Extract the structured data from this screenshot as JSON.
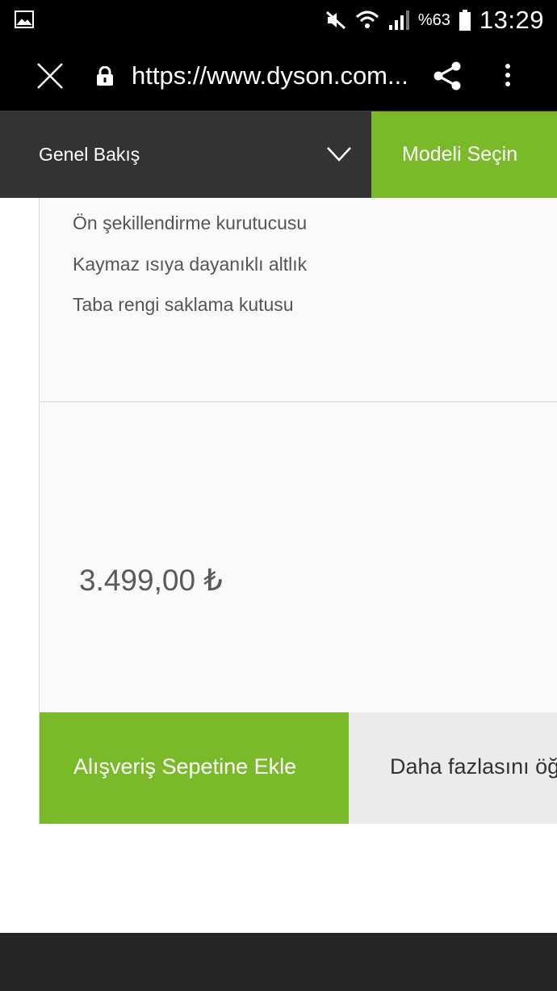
{
  "status_bar": {
    "battery_percent": "%63",
    "time": "13:29",
    "icons": [
      "gallery-icon",
      "mute-icon",
      "wifi-icon",
      "signal-icon",
      "battery-icon"
    ]
  },
  "browser": {
    "url": "https://www.dyson.com...",
    "icons": [
      "close-icon",
      "lock-icon",
      "share-icon",
      "more-options-icon"
    ]
  },
  "subnav": {
    "dropdown_label": "Genel Bakış",
    "cta_label": "Modeli Seçin"
  },
  "product": {
    "features": [
      "Ön şekillendirme kurutucusu",
      "Kaymaz ısıya dayanıklı altlık",
      "Taba rengi saklama kutusu"
    ],
    "price": "3.499,00  ₺",
    "add_to_cart_label": "Alışveriş Sepetine Ekle",
    "learn_more_label": "Daha fazlasını öğrenin"
  },
  "colors": {
    "brand_green": "#7ab929",
    "nav_dark": "#333333",
    "status_black": "#000000"
  }
}
